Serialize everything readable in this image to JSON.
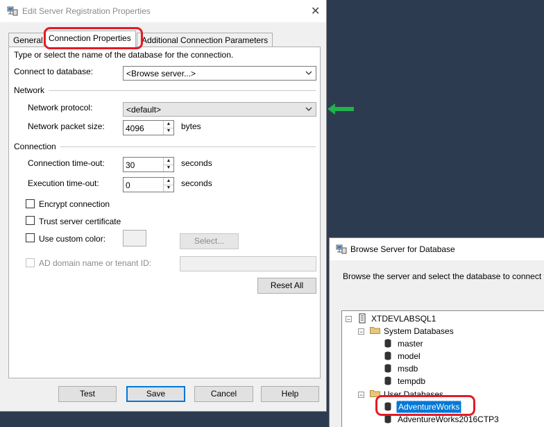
{
  "main_dialog": {
    "title": "Edit Server Registration Properties",
    "tabs": [
      {
        "label": "General",
        "active": false
      },
      {
        "label": "Connection Properties",
        "active": true
      },
      {
        "label": "Additional Connection Parameters",
        "active": false
      }
    ],
    "instruction": "Type or select the name of the database for the connection.",
    "connect_to_database": {
      "label": "Connect to database:",
      "value": "<Browse server...>"
    },
    "network": {
      "group_label": "Network",
      "protocol": {
        "label": "Network protocol:",
        "value": "<default>"
      },
      "packet_size": {
        "label": "Network packet size:",
        "value": "4096",
        "unit": "bytes"
      }
    },
    "connection": {
      "group_label": "Connection",
      "connection_timeout": {
        "label": "Connection time-out:",
        "value": "30",
        "unit": "seconds"
      },
      "execution_timeout": {
        "label": "Execution time-out:",
        "value": "0",
        "unit": "seconds"
      }
    },
    "checkboxes": {
      "encrypt": {
        "label": "Encrypt connection",
        "checked": false
      },
      "trust_cert": {
        "label": "Trust server certificate",
        "checked": false
      },
      "custom_color": {
        "label": "Use custom color:",
        "checked": false
      },
      "ad_domain": {
        "label": "AD domain name or tenant ID:",
        "checked": false,
        "disabled": true
      }
    },
    "select_button": "Select...",
    "reset_all_button": "Reset All",
    "footer_buttons": {
      "test": "Test",
      "save": "Save",
      "cancel": "Cancel",
      "help": "Help"
    }
  },
  "browse_dialog": {
    "title": "Browse Server for Database",
    "instruction": "Browse the server and select the database to connect to",
    "tree": {
      "server": "XTDEVLABSQL1",
      "system_databases": {
        "label": "System Databases",
        "items": [
          "master",
          "model",
          "msdb",
          "tempdb"
        ]
      },
      "user_databases": {
        "label": "User Databases",
        "items": [
          "AdventureWorks",
          "AdventureWorks2016CTP3"
        ]
      },
      "selected_item": "AdventureWorks"
    }
  },
  "colors": {
    "desktop": "#2d3b50",
    "highlight_ring": "#e31b23",
    "arrow": "#22b14c",
    "selection": "#0078d7"
  },
  "icons": [
    "server-registration-icon",
    "close-icon",
    "chevron-down-icon",
    "spin-up-icon",
    "spin-down-icon",
    "green-arrow-icon",
    "server-icon",
    "folder-icon",
    "database-icon"
  ]
}
